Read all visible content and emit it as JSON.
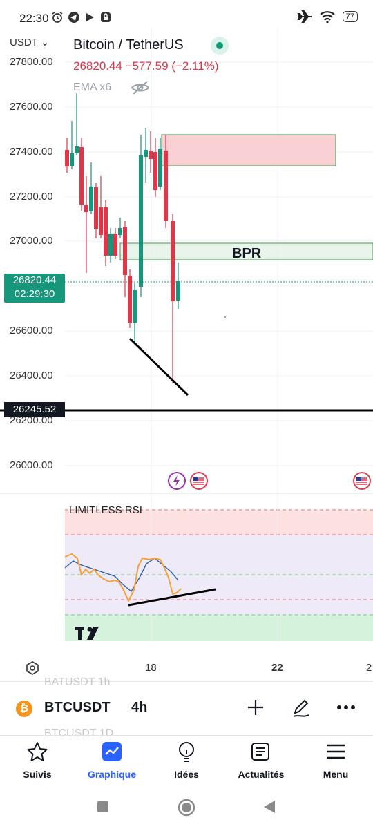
{
  "status": {
    "time": "22:30",
    "battery": "77"
  },
  "chart": {
    "currency": "USDT",
    "title": "Bitcoin / TetherUS",
    "last_price": "26820.44",
    "change": "−577.59 (−2.11%)",
    "indicator_label": "EMA x6",
    "price_tag": {
      "price": "26820.44",
      "countdown": "02:29:30"
    },
    "level_tag": "26245.52",
    "zone_label": "BPR",
    "y_ticks": [
      "27800.00",
      "27600.00",
      "27400.00",
      "27200.00",
      "27000.00",
      "26600.00",
      "26400.00",
      "26200.00",
      "26000.00"
    ],
    "x_ticks": [
      "18",
      "22",
      "2"
    ],
    "rsi_label": "LIMITLESS RSI",
    "colors": {
      "up": "#16967a",
      "down": "#e0364a",
      "accent": "#2962ff"
    }
  },
  "toolbar": {
    "symbol": "BTCUSDT",
    "interval": "4h",
    "ghost_above": "BATUSDT   1h",
    "ghost_below": "BTCUSDT   1D",
    "coin_glyph": "₿"
  },
  "nav": {
    "items": [
      {
        "label": "Suivis",
        "icon": "star-icon"
      },
      {
        "label": "Graphique",
        "icon": "chart-icon"
      },
      {
        "label": "Idées",
        "icon": "lightbulb-icon"
      },
      {
        "label": "Actualités",
        "icon": "news-icon"
      },
      {
        "label": "Menu",
        "icon": "menu-icon"
      }
    ]
  }
}
